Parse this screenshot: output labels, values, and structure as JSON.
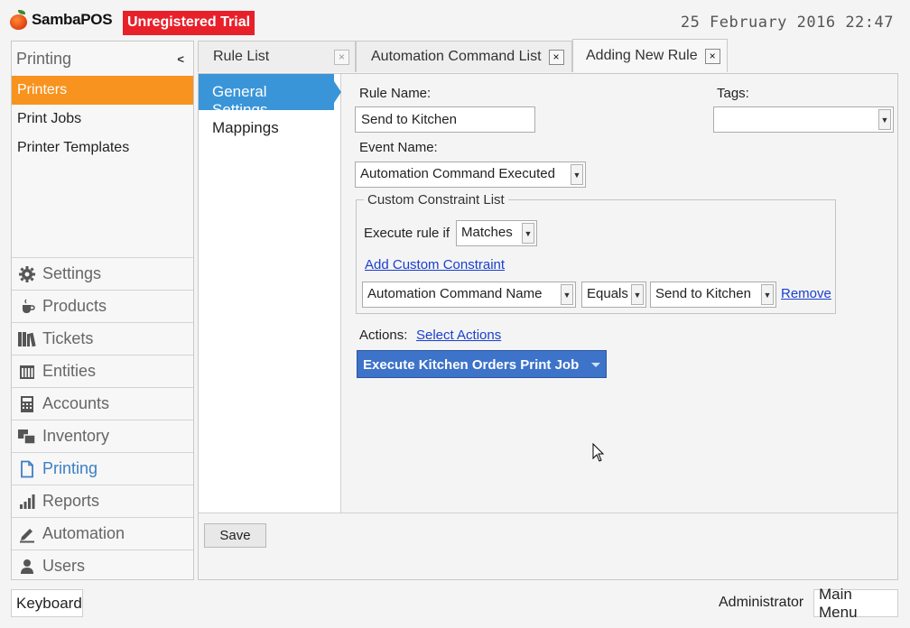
{
  "header": {
    "brand": "SambaPOS",
    "trial_badge": "Unregistered Trial",
    "clock": "25 February 2016 22:47"
  },
  "leftnav": {
    "title": "Printing",
    "subitems": [
      "Printers",
      "Print Jobs",
      "Printer Templates"
    ],
    "active_subitem": "Printers",
    "modules": [
      {
        "label": "Settings",
        "icon": "gear-icon"
      },
      {
        "label": "Products",
        "icon": "coffee-cup-icon"
      },
      {
        "label": "Tickets",
        "icon": "books-icon"
      },
      {
        "label": "Entities",
        "icon": "table-grid-icon"
      },
      {
        "label": "Accounts",
        "icon": "calculator-icon"
      },
      {
        "label": "Inventory",
        "icon": "windows-icon"
      },
      {
        "label": "Printing",
        "icon": "document-icon"
      },
      {
        "label": "Reports",
        "icon": "bar-chart-icon"
      },
      {
        "label": "Automation",
        "icon": "pencil-icon"
      },
      {
        "label": "Users",
        "icon": "user-icon"
      }
    ],
    "active_module": "Printing"
  },
  "tabs": [
    {
      "label": "Rule List",
      "close": "×"
    },
    {
      "label": "Automation Command List",
      "close": "×"
    },
    {
      "label": "Adding New Rule",
      "close": "×"
    }
  ],
  "subnav": {
    "items": [
      "General Settings",
      "Mappings"
    ]
  },
  "form": {
    "rule_name_label": "Rule Name:",
    "rule_name_value": "Send to Kitchen",
    "tags_label": "Tags:",
    "tags_value": "",
    "event_name_label": "Event Name:",
    "event_name_value": "Automation Command Executed",
    "constraint_group_label": "Custom Constraint List",
    "execute_rule_if_label": "Execute rule if",
    "execute_rule_if_value": "Matches",
    "add_constraint_link": "Add Custom Constraint",
    "constraint": {
      "field": "Automation Command Name",
      "operator": "Equals",
      "value": "Send to Kitchen",
      "remove_link": "Remove"
    },
    "actions_label": "Actions:",
    "select_actions_link": "Select Actions",
    "action_item": "Execute Kitchen Orders Print Job"
  },
  "footer": {
    "save_label": "Save"
  },
  "bottombar": {
    "keyboard_label": "Keyboard",
    "user_label": "Administrator",
    "main_menu_label": "Main Menu"
  },
  "colors": {
    "accent_orange": "#f7931e",
    "accent_blue": "#3a95d8",
    "trial_red": "#e8202a",
    "action_blue": "#3d73c9"
  }
}
